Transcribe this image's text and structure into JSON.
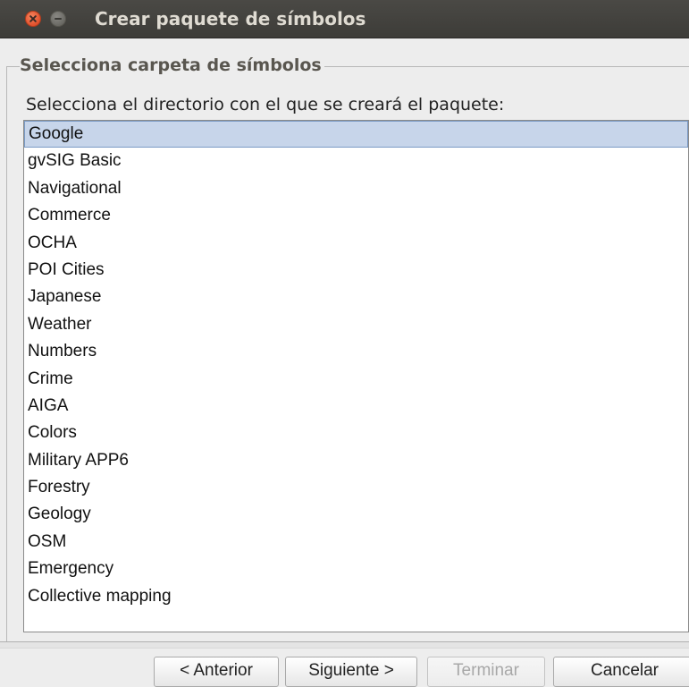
{
  "window": {
    "title": "Crear paquete de símbolos"
  },
  "group": {
    "legend": "Selecciona carpeta de símbolos",
    "instruction": "Selecciona el directorio con el que se creará el paquete:"
  },
  "list": {
    "selected_index": 0,
    "items": [
      "Google",
      "gvSIG Basic",
      "Navigational",
      "Commerce",
      "OCHA",
      "POI Cities",
      "Japanese",
      "Weather",
      "Numbers",
      "Crime",
      "AIGA",
      "Colors",
      "Military APP6",
      "Forestry",
      "Geology",
      "OSM",
      "Emergency",
      "Collective mapping"
    ]
  },
  "buttons": {
    "previous": "< Anterior",
    "next": "Siguiente >",
    "finish": "Terminar",
    "cancel": "Cancelar"
  },
  "colors": {
    "selection": "#c7d5ea",
    "close_button": "#e1502c"
  }
}
